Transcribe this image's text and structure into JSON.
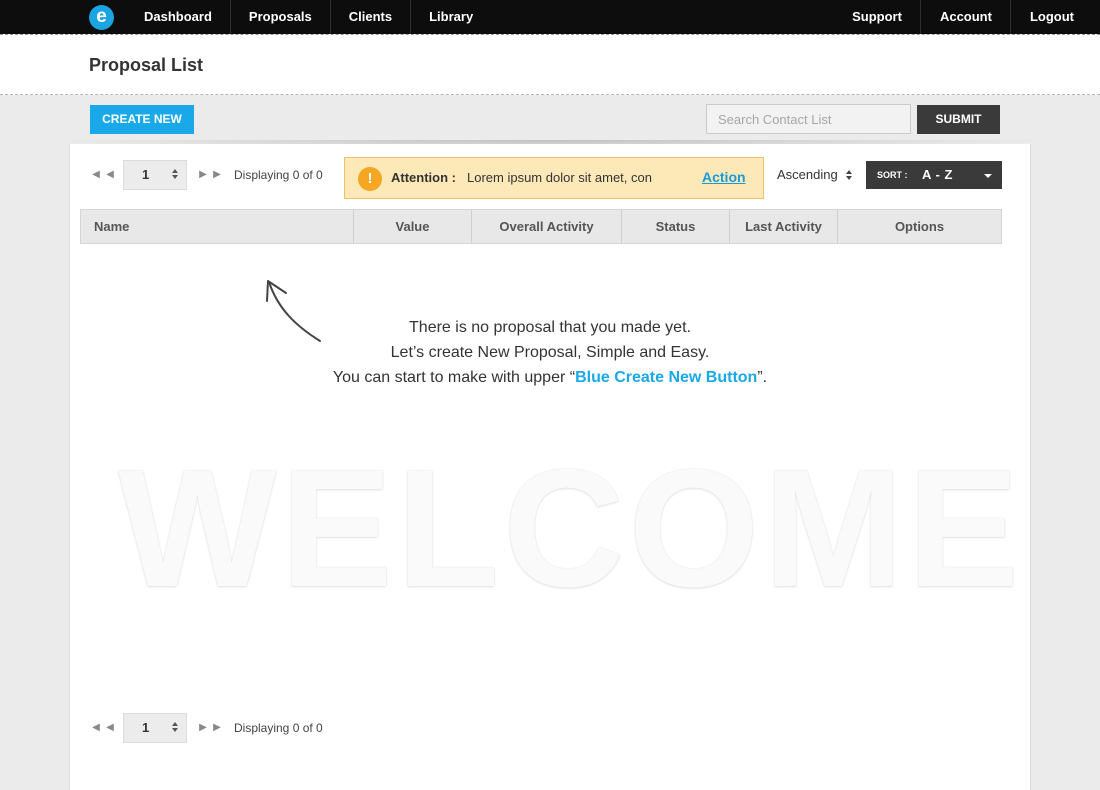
{
  "nav": {
    "logo": "e",
    "left": [
      "Dashboard",
      "Proposals",
      "Clients",
      "Library"
    ],
    "right": [
      "Support",
      "Account",
      "Logout"
    ]
  },
  "header": {
    "title": "Proposal List"
  },
  "toolbar": {
    "create_label": "CREATE NEW",
    "search_placeholder": "Search Contact List",
    "submit_label": "SUBMIT"
  },
  "pager": {
    "page": "1",
    "display_text": "Displaying 0 of 0"
  },
  "attention": {
    "label": "Attention :",
    "message": "Lorem ipsum dolor sit amet, con",
    "action": "Action",
    "icon": "exclamation-icon",
    "color": "#fde9b8"
  },
  "order": {
    "value": "Ascending"
  },
  "sort": {
    "label": "SORT :",
    "value": "A - Z"
  },
  "table": {
    "columns": [
      "Name",
      "Value",
      "Overall Activity",
      "Status",
      "Last Activity",
      "Options"
    ]
  },
  "empty_state": {
    "line1": "There is no proposal that you made yet.",
    "line2": "Let’s create New Proposal, Simple and Easy.",
    "line3_prefix": "You can start to make with upper “",
    "line3_highlight": "Blue Create New Button",
    "line3_suffix": "”."
  },
  "watermark": "WELCOME",
  "colors": {
    "accent": "#1aa9e8",
    "dark": "#3a3a3a",
    "nav_bg": "#0d0d0d",
    "warning": "#f5a623"
  }
}
